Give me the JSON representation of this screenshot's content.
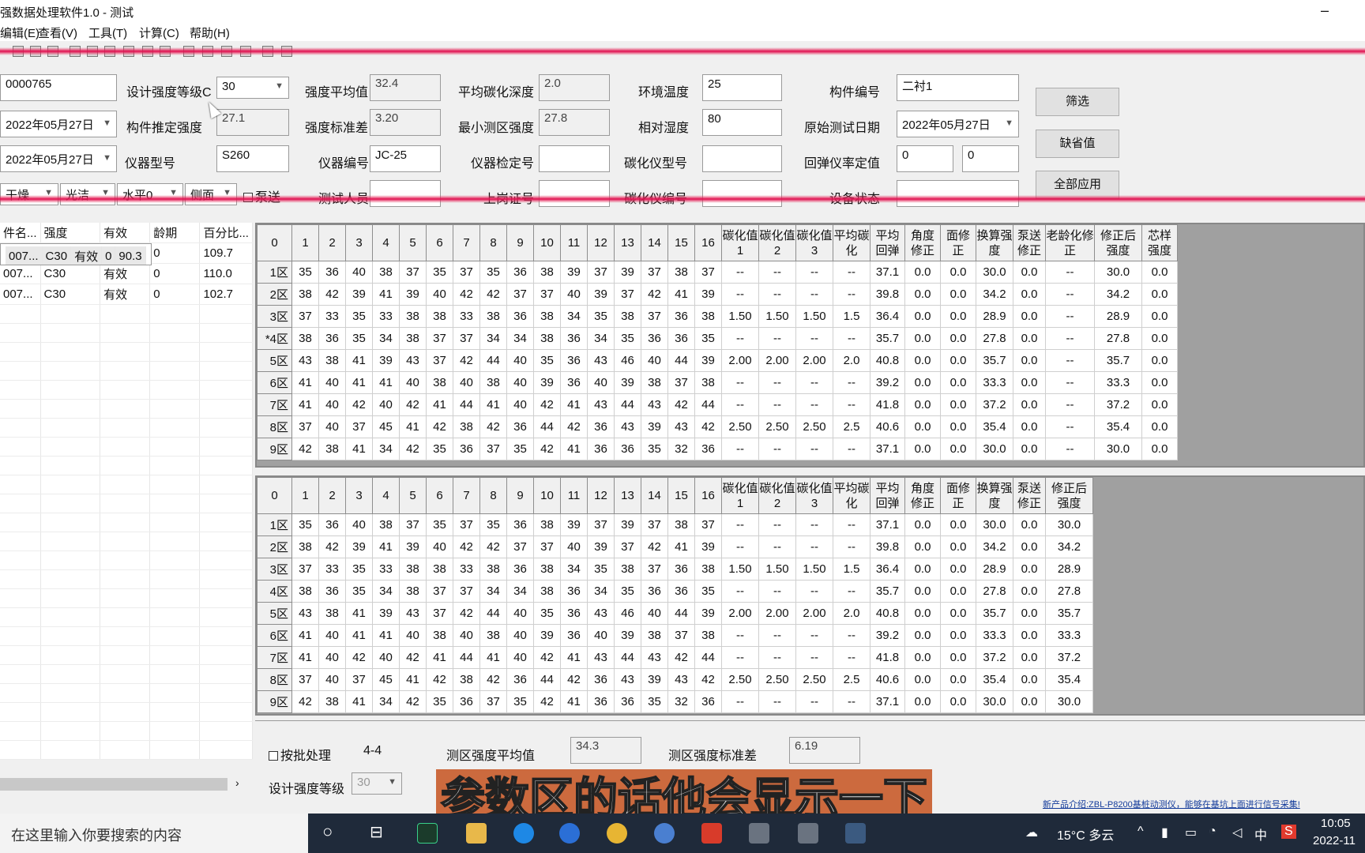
{
  "window": {
    "title": "强数据处理软件1.0 - 测试",
    "minimize": "–"
  },
  "menu": [
    "编辑(E)",
    "查看(V)",
    "工具(T)",
    "计算(C)",
    "帮助(H)"
  ],
  "params": {
    "id_value": "0000765",
    "design_grade_label": "设计强度等级C",
    "design_grade_value": "30",
    "avg_strength_label": "强度平均值",
    "avg_strength_value": "32.4",
    "avg_carbon_label": "平均碳化深度",
    "avg_carbon_value": "2.0",
    "env_temp_label": "环境温度",
    "env_temp_value": "25",
    "member_no_label": "构件编号",
    "member_no_value": "二衬1",
    "date1_value": "2022年05月27日",
    "est_strength_label": "构件推定强度",
    "est_strength_value": "27.1",
    "std_strength_label": "强度标准差",
    "std_strength_value": "3.20",
    "min_zone_label": "最小测区强度",
    "min_zone_value": "27.8",
    "humidity_label": "相对湿度",
    "humidity_value": "80",
    "orig_date_label": "原始测试日期",
    "orig_date_value": "2022年05月27日",
    "date2_value": "2022年05月27日",
    "instr_model_label": "仪器型号",
    "instr_model_value": "S260",
    "instr_no_label": "仪器编号",
    "instr_no_value": "JC-25",
    "instr_cal_label": "仪器检定号",
    "instr_cal_value": "",
    "carbon_model_label": "碳化仪型号",
    "carbon_model_value": "",
    "rebound_cal_label": "回弹仪率定值",
    "rebound_cal_a": "0",
    "rebound_cal_b": "0",
    "dry_value": "干燥",
    "smooth_value": "光洁",
    "level_value": "水平0",
    "side_value": "侧面",
    "pump_label": "泵送",
    "tester_label": "测试人员",
    "post_cert_label": "上岗证号",
    "carbon_no_label": "碳化仪编号",
    "device_status_label": "设备状态"
  },
  "buttons": {
    "filter": "筛选",
    "default": "缺省值",
    "apply_all": "全部应用"
  },
  "left_list": {
    "headers": [
      "件名...",
      "强度",
      "有效",
      "龄期",
      "百分比..."
    ],
    "rows": [
      [
        "007...",
        "C30",
        "有效",
        "0",
        "90.3"
      ],
      [
        "007...",
        "C30",
        "有效",
        "0",
        "109.7"
      ],
      [
        "007...",
        "C30",
        "有效",
        "0",
        "110.0"
      ],
      [
        "007...",
        "C30",
        "有效",
        "0",
        "102.7"
      ]
    ],
    "scroll_right": "›"
  },
  "top_grid": {
    "headers": [
      "0",
      "1",
      "2",
      "3",
      "4",
      "5",
      "6",
      "7",
      "8",
      "9",
      "10",
      "11",
      "12",
      "13",
      "14",
      "15",
      "16",
      "碳化值1",
      "碳化值2",
      "碳化值3",
      "平均碳化",
      "平均回弹",
      "角度修正",
      "面修正",
      "换算强度",
      "泵送修正",
      "老龄化修正",
      "修正后强度",
      "芯样强度"
    ],
    "rows": [
      [
        "1区",
        "35",
        "36",
        "40",
        "38",
        "37",
        "35",
        "37",
        "35",
        "36",
        "38",
        "39",
        "37",
        "39",
        "37",
        "38",
        "37",
        "--",
        "--",
        "--",
        "--",
        "37.1",
        "0.0",
        "0.0",
        "30.0",
        "0.0",
        "--",
        "30.0",
        "0.0"
      ],
      [
        "2区",
        "38",
        "42",
        "39",
        "41",
        "39",
        "40",
        "42",
        "42",
        "37",
        "37",
        "40",
        "39",
        "37",
        "42",
        "41",
        "39",
        "--",
        "--",
        "--",
        "--",
        "39.8",
        "0.0",
        "0.0",
        "34.2",
        "0.0",
        "--",
        "34.2",
        "0.0"
      ],
      [
        "3区",
        "37",
        "33",
        "35",
        "33",
        "38",
        "38",
        "33",
        "38",
        "36",
        "38",
        "34",
        "35",
        "38",
        "37",
        "36",
        "38",
        "1.50",
        "1.50",
        "1.50",
        "1.5",
        "36.4",
        "0.0",
        "0.0",
        "28.9",
        "0.0",
        "--",
        "28.9",
        "0.0"
      ],
      [
        "*4区",
        "38",
        "36",
        "35",
        "34",
        "38",
        "37",
        "37",
        "34",
        "34",
        "38",
        "36",
        "34",
        "35",
        "36",
        "36",
        "35",
        "--",
        "--",
        "--",
        "--",
        "35.7",
        "0.0",
        "0.0",
        "27.8",
        "0.0",
        "--",
        "27.8",
        "0.0"
      ],
      [
        "5区",
        "43",
        "38",
        "41",
        "39",
        "43",
        "37",
        "42",
        "44",
        "40",
        "35",
        "36",
        "43",
        "46",
        "40",
        "44",
        "39",
        "2.00",
        "2.00",
        "2.00",
        "2.0",
        "40.8",
        "0.0",
        "0.0",
        "35.7",
        "0.0",
        "--",
        "35.7",
        "0.0"
      ],
      [
        "6区",
        "41",
        "40",
        "41",
        "41",
        "40",
        "38",
        "40",
        "38",
        "40",
        "39",
        "36",
        "40",
        "39",
        "38",
        "37",
        "38",
        "--",
        "--",
        "--",
        "--",
        "39.2",
        "0.0",
        "0.0",
        "33.3",
        "0.0",
        "--",
        "33.3",
        "0.0"
      ],
      [
        "7区",
        "41",
        "40",
        "42",
        "40",
        "42",
        "41",
        "44",
        "41",
        "40",
        "42",
        "41",
        "43",
        "44",
        "43",
        "42",
        "44",
        "--",
        "--",
        "--",
        "--",
        "41.8",
        "0.0",
        "0.0",
        "37.2",
        "0.0",
        "--",
        "37.2",
        "0.0"
      ],
      [
        "8区",
        "37",
        "40",
        "37",
        "45",
        "41",
        "42",
        "38",
        "42",
        "36",
        "44",
        "42",
        "36",
        "43",
        "39",
        "43",
        "42",
        "2.50",
        "2.50",
        "2.50",
        "2.5",
        "40.6",
        "0.0",
        "0.0",
        "35.4",
        "0.0",
        "--",
        "35.4",
        "0.0"
      ],
      [
        "9区",
        "42",
        "38",
        "41",
        "34",
        "42",
        "35",
        "36",
        "37",
        "35",
        "42",
        "41",
        "36",
        "36",
        "35",
        "32",
        "36",
        "--",
        "--",
        "--",
        "--",
        "37.1",
        "0.0",
        "0.0",
        "30.0",
        "0.0",
        "--",
        "30.0",
        "0.0"
      ]
    ]
  },
  "bottom_grid": {
    "headers": [
      "0",
      "1",
      "2",
      "3",
      "4",
      "5",
      "6",
      "7",
      "8",
      "9",
      "10",
      "11",
      "12",
      "13",
      "14",
      "15",
      "16",
      "碳化值1",
      "碳化值2",
      "碳化值3",
      "平均碳化",
      "平均回弹",
      "角度修正",
      "面修正",
      "换算强度",
      "泵送修正",
      "修正后强度"
    ],
    "rows": [
      [
        "1区",
        "35",
        "36",
        "40",
        "38",
        "37",
        "35",
        "37",
        "35",
        "36",
        "38",
        "39",
        "37",
        "39",
        "37",
        "38",
        "37",
        "--",
        "--",
        "--",
        "--",
        "37.1",
        "0.0",
        "0.0",
        "30.0",
        "0.0",
        "30.0"
      ],
      [
        "2区",
        "38",
        "42",
        "39",
        "41",
        "39",
        "40",
        "42",
        "42",
        "37",
        "37",
        "40",
        "39",
        "37",
        "42",
        "41",
        "39",
        "--",
        "--",
        "--",
        "--",
        "39.8",
        "0.0",
        "0.0",
        "34.2",
        "0.0",
        "34.2"
      ],
      [
        "3区",
        "37",
        "33",
        "35",
        "33",
        "38",
        "38",
        "33",
        "38",
        "36",
        "38",
        "34",
        "35",
        "38",
        "37",
        "36",
        "38",
        "1.50",
        "1.50",
        "1.50",
        "1.5",
        "36.4",
        "0.0",
        "0.0",
        "28.9",
        "0.0",
        "28.9"
      ],
      [
        "4区",
        "38",
        "36",
        "35",
        "34",
        "38",
        "37",
        "37",
        "34",
        "34",
        "38",
        "36",
        "34",
        "35",
        "36",
        "36",
        "35",
        "--",
        "--",
        "--",
        "--",
        "35.7",
        "0.0",
        "0.0",
        "27.8",
        "0.0",
        "27.8"
      ],
      [
        "5区",
        "43",
        "38",
        "41",
        "39",
        "43",
        "37",
        "42",
        "44",
        "40",
        "35",
        "36",
        "43",
        "46",
        "40",
        "44",
        "39",
        "2.00",
        "2.00",
        "2.00",
        "2.0",
        "40.8",
        "0.0",
        "0.0",
        "35.7",
        "0.0",
        "35.7"
      ],
      [
        "6区",
        "41",
        "40",
        "41",
        "41",
        "40",
        "38",
        "40",
        "38",
        "40",
        "39",
        "36",
        "40",
        "39",
        "38",
        "37",
        "38",
        "--",
        "--",
        "--",
        "--",
        "39.2",
        "0.0",
        "0.0",
        "33.3",
        "0.0",
        "33.3"
      ],
      [
        "7区",
        "41",
        "40",
        "42",
        "40",
        "42",
        "41",
        "44",
        "41",
        "40",
        "42",
        "41",
        "43",
        "44",
        "43",
        "42",
        "44",
        "--",
        "--",
        "--",
        "--",
        "41.8",
        "0.0",
        "0.0",
        "37.2",
        "0.0",
        "37.2"
      ],
      [
        "8区",
        "37",
        "40",
        "37",
        "45",
        "41",
        "42",
        "38",
        "42",
        "36",
        "44",
        "42",
        "36",
        "43",
        "39",
        "43",
        "42",
        "2.50",
        "2.50",
        "2.50",
        "2.5",
        "40.6",
        "0.0",
        "0.0",
        "35.4",
        "0.0",
        "35.4"
      ],
      [
        "9区",
        "42",
        "38",
        "41",
        "34",
        "42",
        "35",
        "36",
        "37",
        "35",
        "42",
        "41",
        "36",
        "36",
        "35",
        "32",
        "36",
        "--",
        "--",
        "--",
        "--",
        "37.1",
        "0.0",
        "0.0",
        "30.0",
        "0.0",
        "30.0"
      ]
    ]
  },
  "summary": {
    "batch_label": "按批处理",
    "batch_value": "4-4",
    "zone_avg_label": "测区强度平均值",
    "zone_avg_value": "34.3",
    "zone_std_label": "测区强度标准差",
    "zone_std_value": "6.19",
    "design_grade_label": "设计强度等级",
    "design_grade_value": "30"
  },
  "promo": "新产品介绍:ZBL-P8200基桩动测仪，能够在基坑上面进行信号采集!",
  "caption": "参数区的话他会显示一下",
  "taskbar": {
    "search_placeholder": "在这里输入你要搜索的内容",
    "weather": "15°C 多云",
    "ime": "中",
    "time": "10:05",
    "date": "2022-11"
  },
  "colors": {
    "caption_bg": "#cc6a3e",
    "redline": "#e01050",
    "taskbar": "#1f2a3a"
  }
}
